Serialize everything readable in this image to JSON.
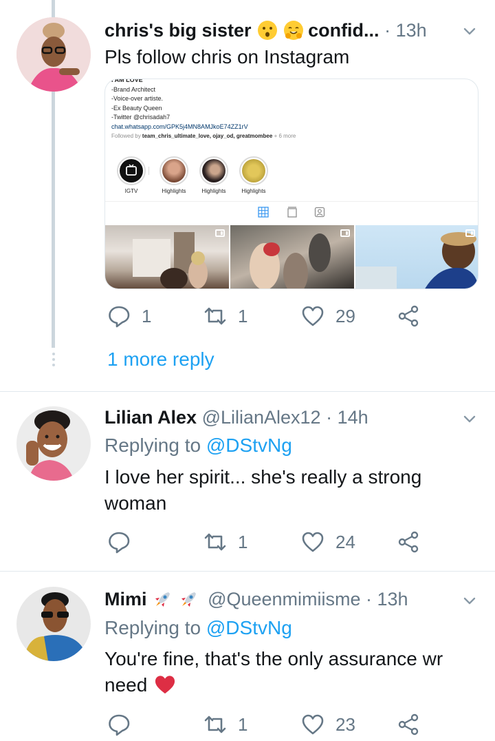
{
  "colors": {
    "link": "#1da1f2",
    "muted": "#657786",
    "text": "#14171a",
    "heart_red": "#e0245e",
    "divider": "#e1e8ed"
  },
  "tweets": [
    {
      "name": "chris's big sister",
      "name_suffix": "confid...",
      "emojis": [
        "kissing-face-emoji",
        "hugging-face-emoji"
      ],
      "meta": "· 13h",
      "text": "Pls follow chris on Instagram",
      "actions": {
        "reply": "1",
        "retweet": "1",
        "like": "29"
      }
    },
    {
      "name": "Lilian Alex",
      "meta": "@LilianAlex12 · 14h",
      "replying_prefix": "Replying to",
      "replying_handle": "@DStvNg",
      "text": "I love her spirit... she's really a strong woman",
      "actions": {
        "reply": "",
        "retweet": "1",
        "like": "24"
      }
    },
    {
      "name": "Mimi",
      "emojis": [
        "rocket-emoji",
        "rocket-emoji"
      ],
      "meta": "@Queenmimiisme · 13h",
      "replying_prefix": "Replying to",
      "replying_handle": "@DStvNg",
      "text": "You're fine, that's the only assurance wr need",
      "actions": {
        "reply": "",
        "retweet": "1",
        "like": "23"
      }
    }
  ],
  "more_reply": "1 more reply",
  "instagram_card": {
    "bio_lines": [
      "I AM LOVE",
      "-Brand Architect",
      "-Voice-over artiste.",
      "-Ex Beauty Queen",
      "-Twitter @chrisadah7"
    ],
    "link": "chat.whatsapp.com/GPK5j4MN8AMJkoE74ZZ1rV",
    "followed_prefix": "Followed by",
    "followed_names": "team_chris_ultimate_love, ojay_od, greatmombee",
    "followed_suffix": "+ 6 more",
    "highlights": [
      "IGTV",
      "Highlights",
      "Highlights",
      "Highlights"
    ]
  }
}
